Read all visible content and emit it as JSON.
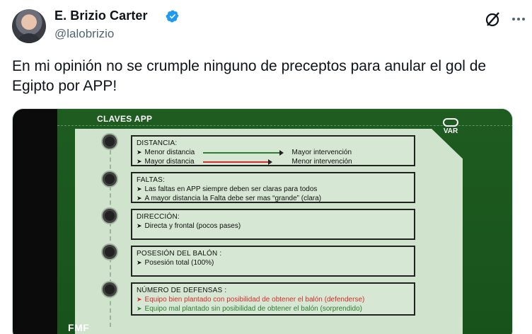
{
  "author": {
    "display_name": "E. Brizio Carter",
    "handle": "@lalobrizio",
    "verified": true,
    "avatar_icon": "profile-photo"
  },
  "tweet": {
    "text": "En mi opinión no se crumple ninguno de preceptos para anular el  gol de Egipto por APP!"
  },
  "actions": {
    "grok_icon": "grok-icon",
    "more_icon": "more-options-icon"
  },
  "slide": {
    "title": "CLAVES APP",
    "var_label": "VAR",
    "fmf_label": "FMF",
    "sections": [
      {
        "heading": "DISTANCIA:",
        "rows": [
          {
            "left": "Menor distancia",
            "right": "Mayor intervención",
            "line_color": "#2e7d32"
          },
          {
            "left": "Mayor distancia",
            "right": "Menor intervención",
            "line_color": "#d32f2f"
          }
        ]
      },
      {
        "heading": "FALTAS:",
        "rows": [
          {
            "text": "Las faltas en APP siempre deben ser claras para todos"
          },
          {
            "text": "A mayor distancia la Falta debe ser mas “grande” (clara)"
          }
        ]
      },
      {
        "heading": "DIRECCIÓN:",
        "rows": [
          {
            "text": "Directa y frontal  (pocos pases)"
          }
        ]
      },
      {
        "heading": "POSESIÓN DEL BALÓN :",
        "rows": [
          {
            "text": "Posesión total (100%)"
          }
        ]
      },
      {
        "heading": "NÚMERO DE DEFENSAS :",
        "rows": [
          {
            "text": "Equipo bien plantado con posibilidad de obtener el balón (defenderse)",
            "color": "#d32f2f"
          },
          {
            "text": "Equipo mal plantado sin posibilidad de obtener el balón (sorprendido)",
            "color": "#2e7d32"
          }
        ]
      }
    ]
  },
  "colors": {
    "verified_badge": "#1d9bf0",
    "handle": "#536471",
    "pitch": "#1e5c20",
    "panel": "#cfe3cd"
  }
}
